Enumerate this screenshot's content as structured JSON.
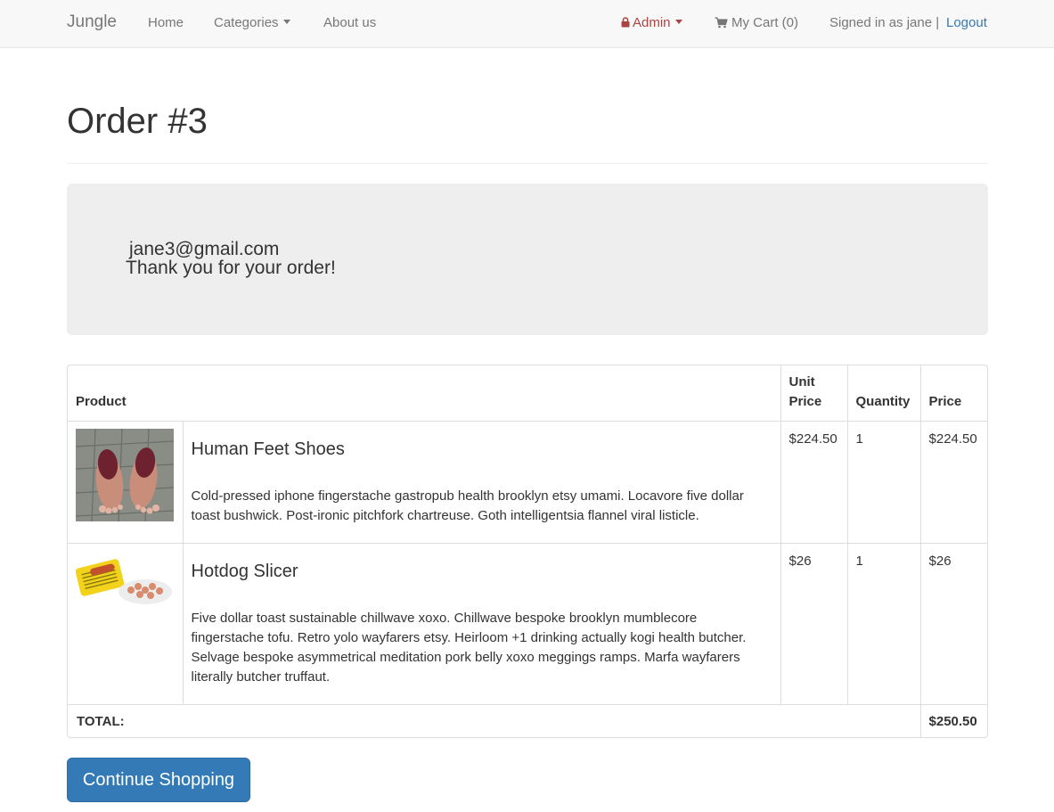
{
  "navbar": {
    "brand": "Jungle",
    "links": {
      "home": "Home",
      "categories": "Categories",
      "about": "About us"
    },
    "admin": "Admin",
    "cart": "My Cart (0)",
    "signed_in": "Signed in as jane |",
    "logout": "Logout"
  },
  "page": {
    "title": "Order #3"
  },
  "jumbotron": {
    "email": "jane3@gmail.com",
    "message": "Thank you for your order!"
  },
  "table": {
    "headers": {
      "product": "Product",
      "unit_price": "Unit Price",
      "quantity": "Quantity",
      "price": "Price"
    },
    "rows": [
      {
        "name": "Human Feet Shoes",
        "description": "Cold-pressed iphone fingerstache gastropub health brooklyn etsy umami. Locavore five dollar toast bushwick. Post-ironic pitchfork chartreuse. Goth intelligentsia flannel viral listicle.",
        "unit_price": "$224.50",
        "quantity": "1",
        "price": "$224.50"
      },
      {
        "name": "Hotdog Slicer",
        "description": "Five dollar toast sustainable chillwave xoxo. Chillwave bespoke brooklyn mumblecore fingerstache tofu. Retro yolo wayfarers etsy. Heirloom +1 drinking actually kogi health butcher. Selvage bespoke asymmetrical meditation pork belly xoxo meggings ramps. Marfa wayfarers literally butcher truffaut.",
        "unit_price": "$26",
        "quantity": "1",
        "price": "$26"
      }
    ],
    "total_label": "TOTAL:",
    "total_value": "$250.50"
  },
  "actions": {
    "continue": "Continue Shopping"
  },
  "colors": {
    "link": "#337ab7",
    "admin": "#a94442",
    "button": "#337ab7"
  }
}
